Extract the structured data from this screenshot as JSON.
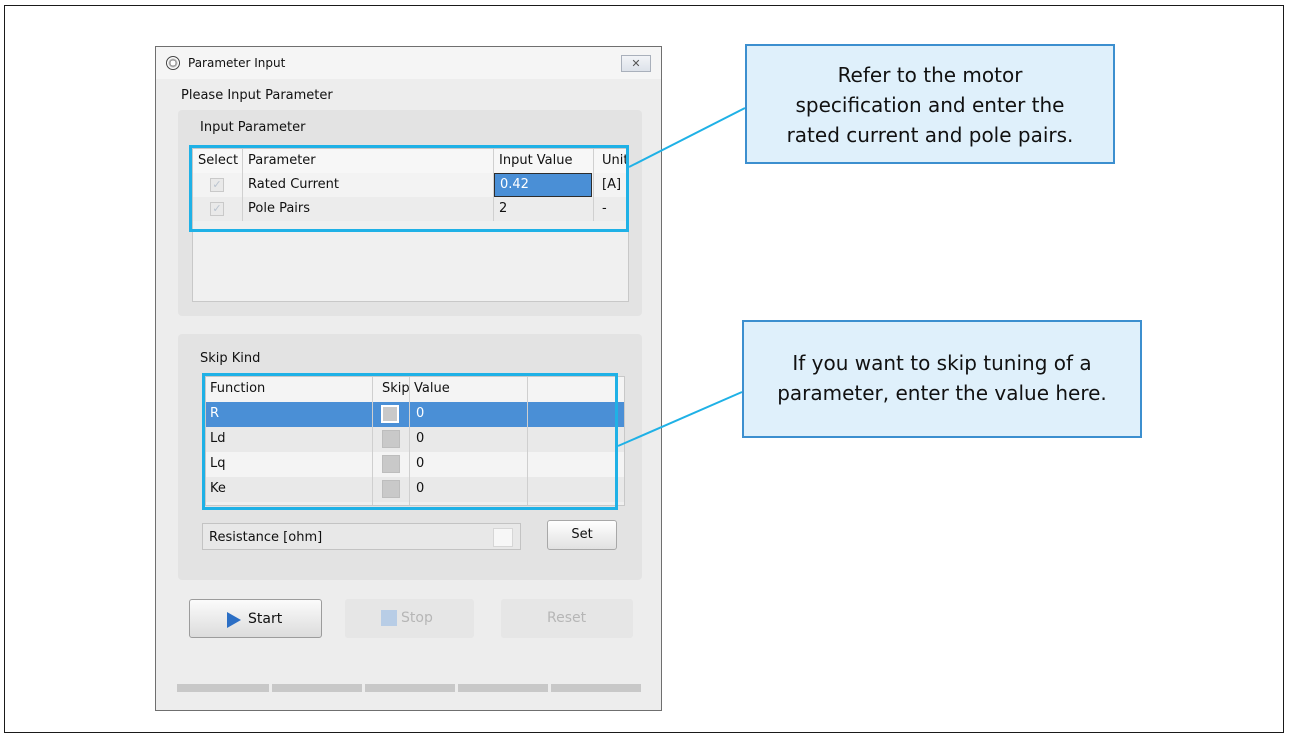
{
  "window": {
    "title": "Parameter Input",
    "close_glyph": "✕",
    "prompt": "Please Input Parameter"
  },
  "input_parameter": {
    "group_label": "Input Parameter",
    "columns": [
      "Select",
      "Parameter",
      "Input Value",
      "Unit"
    ],
    "rows": [
      {
        "selected": true,
        "parameter": "Rated Current",
        "value": "0.42",
        "unit": "[A]"
      },
      {
        "selected": true,
        "parameter": "Pole Pairs",
        "value": "2",
        "unit": "-"
      }
    ]
  },
  "skip_kind": {
    "group_label": "Skip Kind",
    "columns": [
      "Function",
      "Skip",
      "Value",
      ""
    ],
    "rows": [
      {
        "function": "R",
        "skip": false,
        "value": "0"
      },
      {
        "function": "Ld",
        "skip": false,
        "value": "0"
      },
      {
        "function": "Lq",
        "skip": false,
        "value": "0"
      },
      {
        "function": "Ke",
        "skip": false,
        "value": "0"
      }
    ],
    "selected_row": "R",
    "resistance_label": "Resistance [ohm]",
    "set_label": "Set"
  },
  "buttons": {
    "start": "Start",
    "stop": "Stop",
    "reset": "Reset"
  },
  "callouts": {
    "top": [
      "Refer to the motor",
      "specification and enter the",
      "rated current and pole pairs."
    ],
    "bottom": [
      "If you want to skip tuning of a",
      "parameter, enter the value here."
    ]
  },
  "colors": {
    "highlight": "#1fb1e6",
    "callout_fill": "#dff0fb",
    "callout_border": "#3c8fcf",
    "selection": "#4a8fd6"
  },
  "icons": [
    "app-icon",
    "close-icon",
    "play-icon",
    "stop-icon",
    "checkbox-checked-icon"
  ]
}
